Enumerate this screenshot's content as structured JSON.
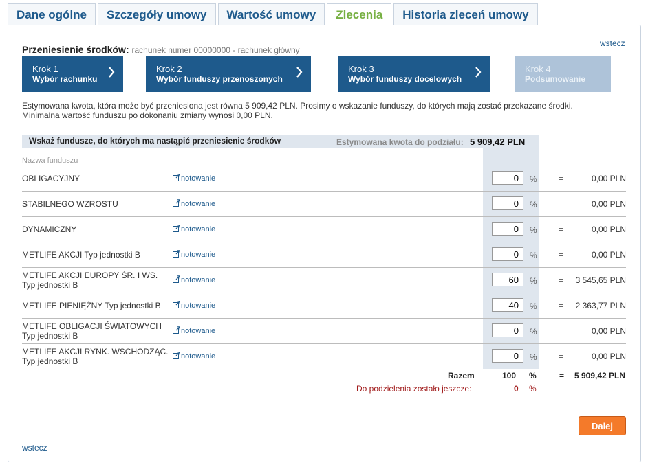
{
  "tabs": [
    {
      "label": "Dane ogólne"
    },
    {
      "label": "Szczegóły umowy"
    },
    {
      "label": "Wartość umowy"
    },
    {
      "label": "Zlecenia",
      "active": true
    },
    {
      "label": "Historia zleceń umowy"
    }
  ],
  "back_link": "wstecz",
  "transfer": {
    "label": "Przeniesienie środków:",
    "value": "rachunek numer 00000000 - rachunek główny"
  },
  "steps": [
    {
      "num": "Krok 1",
      "title": "Wybór rachunku"
    },
    {
      "num": "Krok 2",
      "title": "Wybór funduszy przenoszonych"
    },
    {
      "num": "Krok 3",
      "title": "Wybór funduszy docelowych"
    },
    {
      "num": "Krok 4",
      "title": "Podsumowanie"
    }
  ],
  "intro": "Estymowana kwota, która może być przeniesiona jest równa 5 909,42 PLN. Prosimy o wskazanie funduszy, do których mają zostać przekazane środki. Minimalna wartość funduszu po dokonaniu zmiany wynosi 0,00 PLN.",
  "table": {
    "header": "Wskaż fundusze, do których ma nastąpić przeniesienie środków",
    "estimate_label": "Estymowana kwota do podziału:",
    "estimate_value": "5 909,42 PLN",
    "col_name": "Nazwa funduszu",
    "quote_label": "notowanie",
    "pct_symbol": "%",
    "eq_symbol": "=",
    "rows": [
      {
        "name": "OBLIGACYJNY",
        "pct": "0",
        "amount": "0,00 PLN"
      },
      {
        "name": "STABILNEGO WZROSTU",
        "pct": "0",
        "amount": "0,00 PLN"
      },
      {
        "name": "DYNAMICZNY",
        "pct": "0",
        "amount": "0,00 PLN"
      },
      {
        "name": "METLIFE AKCJI Typ jednostki B",
        "pct": "0",
        "amount": "0,00 PLN"
      },
      {
        "name": "METLIFE AKCJI EUROPY ŚR. I WS. Typ jednostki B",
        "pct": "60",
        "amount": "3 545,65 PLN"
      },
      {
        "name": "METLIFE PIENIĘŻNY Typ jednostki B",
        "pct": "40",
        "amount": "2 363,77 PLN"
      },
      {
        "name": "METLIFE OBLIGACJI ŚWIATOWYCH Typ jednostki B",
        "pct": "0",
        "amount": "0,00 PLN"
      },
      {
        "name": "METLIFE AKCJI RYNK. WSCHODZĄC. Typ jednostki B",
        "pct": "0",
        "amount": "0,00 PLN"
      }
    ],
    "total_label": "Razem",
    "total_pct": "100",
    "total_amount": "5 909,42 PLN",
    "remain_label": "Do podzielenia zostało jeszcze:",
    "remain_value": "0"
  },
  "next_button": "Dalej",
  "colors": {
    "brand": "#1e5a8c",
    "active_tab": "#77b043",
    "step_disabled": "#aec3d9",
    "button": "#f47a2a",
    "warning": "#a11c1c"
  }
}
